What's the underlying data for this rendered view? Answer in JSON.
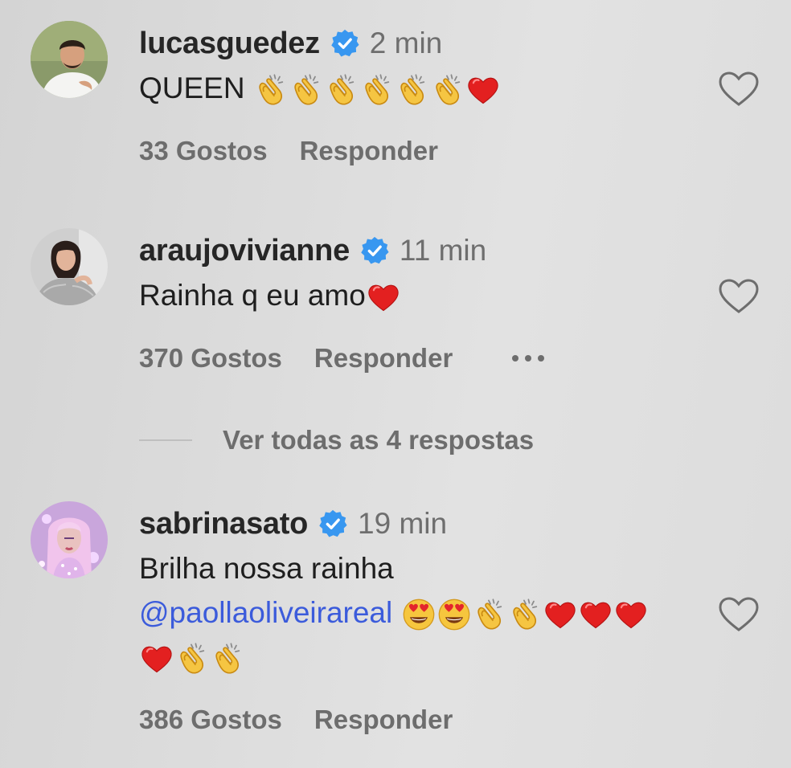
{
  "comments": [
    {
      "username": "lucasguedez",
      "time": "2 min",
      "text": "QUEEN ",
      "likes": "33 Gostos",
      "reply": "Responder"
    },
    {
      "username": "araujovivianne",
      "time": "11 min",
      "text": "Rainha q eu amo",
      "likes": "370 Gostos",
      "reply": "Responder"
    },
    {
      "username": "sabrinasato",
      "time": "19 min",
      "text_line1": "Brilha nossa rainha",
      "mention": "@paollaoliveirareal",
      "likes": "386 Gostos",
      "reply": "Responder"
    }
  ],
  "view_replies": "Ver todas as 4 respostas",
  "icons": {
    "verified": "verified-badge-icon",
    "like": "heart-outline-icon",
    "more": "more-options-icon"
  },
  "colors": {
    "verified": "#3897f0",
    "mention": "#3b5bdb",
    "text": "#262626",
    "secondary": "#6d6d6d"
  }
}
